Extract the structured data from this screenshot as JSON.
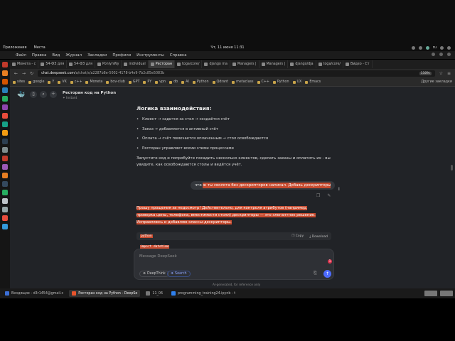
{
  "system": {
    "apps_menu": "Приложения",
    "places_menu": "Места",
    "clock": "Чт, 11 июня  11:31",
    "lang": "ru"
  },
  "menubar": [
    "Файл",
    "Правка",
    "Вид",
    "Журнал",
    "Закладки",
    "Профили",
    "Инструменты",
    "Справка"
  ],
  "tabs": [
    {
      "label": "Монета - с",
      "active": false
    },
    {
      "label": "54-ФЗ для",
      "active": false
    },
    {
      "label": "54-ФЗ для",
      "active": false
    },
    {
      "label": "PonlynWy",
      "active": false
    },
    {
      "label": "individual",
      "active": false
    },
    {
      "label": "Ресторан",
      "active": true
    },
    {
      "label": "toga/core/",
      "active": false
    },
    {
      "label": "django ma",
      "active": false
    },
    {
      "label": "Managers |",
      "active": false
    },
    {
      "label": "Managers |",
      "active": false
    },
    {
      "label": "django/dja",
      "active": false
    },
    {
      "label": "toga/core/",
      "active": false
    },
    {
      "label": "Видео - Ст",
      "active": false
    }
  ],
  "url": {
    "host": "chat.deepseek.com",
    "path": "/a/chat/s/a2287b8e-5002-4178-b4e9-7b2c85e5083b",
    "zoom": "110%"
  },
  "bookmarks": [
    "sites",
    "google",
    "Y",
    "VK",
    "c++",
    "Moneta",
    "bov-club",
    "GPT",
    "PY",
    "vpn",
    "db",
    "AI",
    "Python",
    "Qdrant",
    "metaclass",
    "C++",
    "Python",
    "UX",
    "Emacs"
  ],
  "bookmarks_more": "Другие закладки",
  "chat": {
    "title": "Ресторан код на Python",
    "subtitle": "Instant",
    "heading": "Логика взаимодействия:",
    "bullets": [
      "Клиент → садится за стол → создаётся счёт",
      "Заказ → добавляется в активный счёт",
      "Оплата → счёт помечается оплаченным → стол освобождается",
      "Ресторан управляет всеми этими процессами"
    ],
    "paragraph": "Запустите код и попробуйте посадить несколько клиентов, сделать заказы и оплатить их - вы увидите, как освобождаются столы и ведётся учёт.",
    "user_prefix": "что",
    "user_highlight": "ж ты сволота без дескрипторов написал. Добавь дескрипторы",
    "answer_lines": [
      "Прошу прощения за недосмотр! Действительно, для контроля атрибутов (например,",
      "проверка цены, телефона, вместимости столи) дескрипторы — это элегантное решение.",
      "Исправляюсь и добавляю классы-дескрипторы."
    ],
    "code_lang": "python",
    "copy_label": "Copy",
    "download_label": "Download",
    "code_line": "import datetime"
  },
  "composer": {
    "placeholder": "Message DeepSeek",
    "deepthink": "DeepThink",
    "search": "Search",
    "badge": "1"
  },
  "disclaimer": "AI-generated, for reference only",
  "taskbar": [
    {
      "label": "Входящие - d3r1454@gmail.c",
      "active": false,
      "color": "#3b6fd6"
    },
    {
      "label": "Ресторан код на Python - DeepSe",
      "active": true,
      "color": "#e8542c"
    },
    {
      "label": "11_06",
      "active": false,
      "color": "#777"
    },
    {
      "label": "programming_training24.ipynb - t",
      "active": false,
      "color": "#2f80ed"
    }
  ]
}
